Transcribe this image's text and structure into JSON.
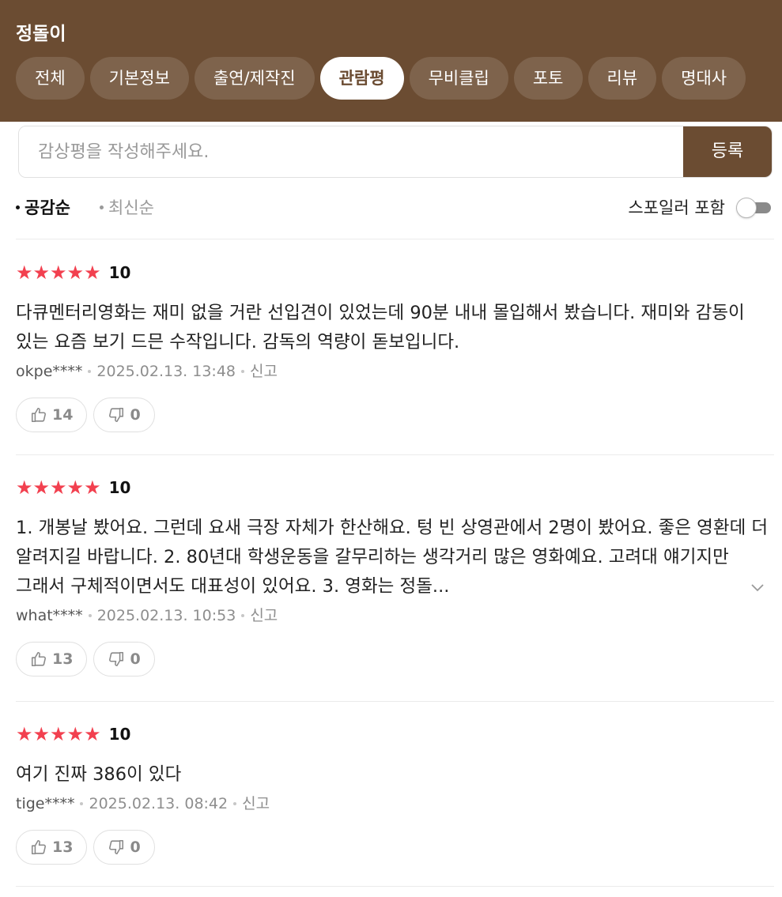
{
  "header": {
    "title": "정돌이",
    "tabs": [
      {
        "label": "전체"
      },
      {
        "label": "기본정보"
      },
      {
        "label": "출연/제작진"
      },
      {
        "label": "관람평"
      },
      {
        "label": "무비클립"
      },
      {
        "label": "포토"
      },
      {
        "label": "리뷰"
      },
      {
        "label": "명대사"
      }
    ],
    "active_tab": "관람평"
  },
  "review_input": {
    "placeholder": "감상평을 작성해주세요.",
    "value": "",
    "submit_label": "등록"
  },
  "sort": {
    "options": [
      {
        "label": "공감순",
        "active": true
      },
      {
        "label": "최신순",
        "active": false
      }
    ],
    "spoiler_label": "스포일러 포함",
    "spoiler_enabled": false
  },
  "colors": {
    "brand": "#6b4c32",
    "star": "#f2404f"
  },
  "reviews": [
    {
      "stars": "★★★★★",
      "score": "10",
      "text": "다큐멘터리영화는 재미 없을 거란 선입견이 있었는데 90분 내내 몰입해서 봤습니다. 재미와 감동이 있는 요즘 보기 드믄 수작입니다. 감독의 역량이 돋보입니다.",
      "user": "okpe****",
      "date": "2025.02.13. 13:48",
      "report": "신고",
      "likes": "14",
      "dislikes": "0"
    },
    {
      "stars": "★★★★★",
      "score": "10",
      "text": "1. 개봉날 봤어요. 그런데 요새 극장 자체가 한산해요. 텅 빈 상영관에서 2명이 봤어요. 좋은 영환데 더 알려지길 바랍니다. 2. 80년대 학생운동을 갈무리하는 생각거리 많은 영화예요. 고려대 얘기지만 그래서 구체적이면서도 대표성이 있어요. 3. 영화는 정돌...",
      "user": "what****",
      "date": "2025.02.13. 10:53",
      "report": "신고",
      "likes": "13",
      "dislikes": "0"
    },
    {
      "stars": "★★★★★",
      "score": "10",
      "text": "여기 진짜 386이 있다",
      "user": "tige****",
      "date": "2025.02.13. 08:42",
      "report": "신고",
      "likes": "13",
      "dislikes": "0"
    }
  ]
}
